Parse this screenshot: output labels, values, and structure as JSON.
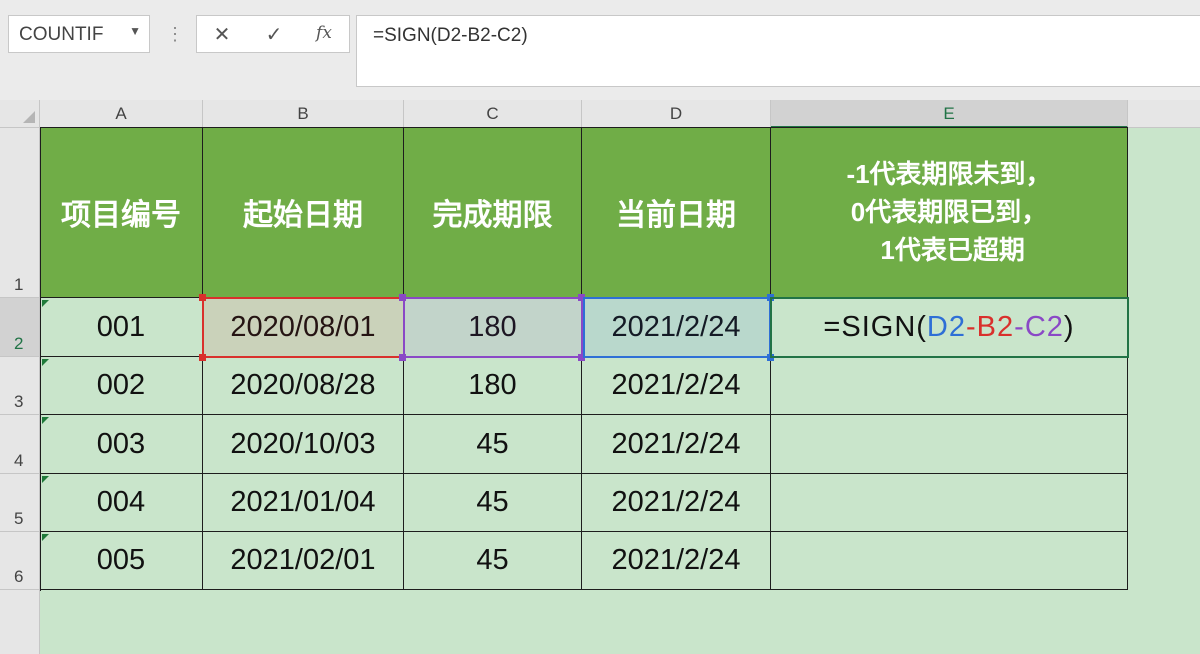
{
  "formula_bar": {
    "name_box": "COUNTIF",
    "formula": "=SIGN(D2-B2-C2)"
  },
  "columns": [
    "A",
    "B",
    "C",
    "D",
    "E"
  ],
  "rows": [
    "1",
    "2",
    "3",
    "4",
    "5",
    "6"
  ],
  "headers": {
    "a": "项目编号",
    "b": "起始日期",
    "c": "完成期限",
    "d": "当前日期",
    "e": "-1代表期限未到，\n0代表期限已到，\n 1代表已超期"
  },
  "data": [
    {
      "id": "001",
      "start": "2020/08/01",
      "limit": "180",
      "current": "2021/2/24"
    },
    {
      "id": "002",
      "start": "2020/08/28",
      "limit": "180",
      "current": "2021/2/24"
    },
    {
      "id": "003",
      "start": "2020/10/03",
      "limit": "45",
      "current": "2021/2/24"
    },
    {
      "id": "004",
      "start": "2021/01/04",
      "limit": "45",
      "current": "2021/2/24"
    },
    {
      "id": "005",
      "start": "2021/02/01",
      "limit": "45",
      "current": "2021/2/24"
    }
  ],
  "edit_cell": {
    "prefix": "=SIGN(",
    "d": "D2",
    "minus1": "-",
    "b": "B2",
    "minus2": "-",
    "c": "C2",
    "suffix": ")"
  },
  "colors": {
    "header_fill": "#70ad47",
    "sheet_fill": "#c9e5cb",
    "ref_d": "#2e6fd6",
    "ref_b": "#d9302c",
    "ref_c": "#8a48c6"
  }
}
